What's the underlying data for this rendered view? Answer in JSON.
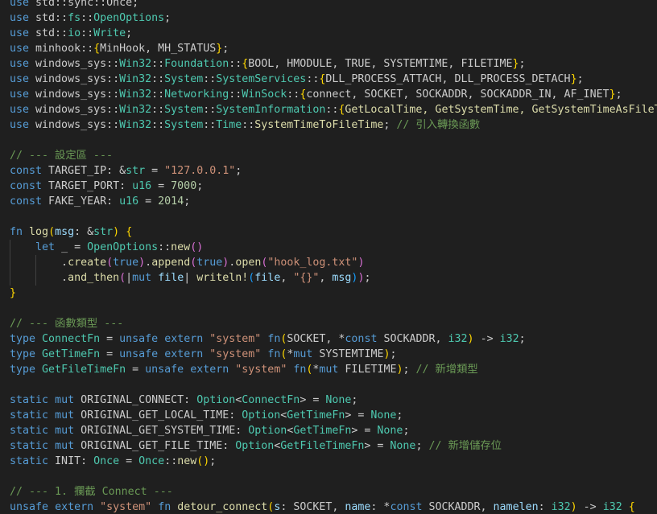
{
  "editor": {
    "colors": {
      "background": "#1f1f1f",
      "text": "#cccccc",
      "keyword": "#569cd6",
      "control": "#c586c0",
      "type": "#4ec9b0",
      "function": "#dcdcaa",
      "string": "#ce9178",
      "number": "#b5cea8",
      "comment": "#6a9955",
      "variable": "#9cdcfe",
      "constant": "#cccccc",
      "bracket_gold": "#ffd700",
      "bracket_purple": "#da70d6",
      "bracket_blue": "#179fff",
      "indent_guide": "#404040"
    },
    "lines": [
      [
        [
          "use",
          "keyword"
        ],
        [
          " std::sync::Once;",
          "text"
        ]
      ],
      [
        [
          "use",
          "keyword"
        ],
        [
          " std::",
          "text"
        ],
        [
          "fs",
          "type"
        ],
        [
          "::",
          "text"
        ],
        [
          "OpenOptions",
          "type"
        ],
        [
          ";",
          "text"
        ]
      ],
      [
        [
          "use",
          "keyword"
        ],
        [
          " std::",
          "text"
        ],
        [
          "io",
          "type"
        ],
        [
          "::",
          "text"
        ],
        [
          "Write",
          "type"
        ],
        [
          ";",
          "text"
        ]
      ],
      [
        [
          "use",
          "keyword"
        ],
        [
          " minhook::",
          "text"
        ],
        [
          "{",
          "bracket_gold"
        ],
        [
          "MinHook, MH_STATUS",
          "text"
        ],
        [
          "}",
          "bracket_gold"
        ],
        [
          ";",
          "text"
        ]
      ],
      [
        [
          "use",
          "keyword"
        ],
        [
          " windows_sys",
          "text"
        ],
        [
          "::",
          "text"
        ],
        [
          "Win32",
          "type"
        ],
        [
          "::",
          "text"
        ],
        [
          "Foundation",
          "type"
        ],
        [
          "::",
          "text"
        ],
        [
          "{",
          "bracket_gold"
        ],
        [
          "BOOL, HMODULE, TRUE, SYSTEMTIME, FILETIME",
          "text"
        ],
        [
          "}",
          "bracket_gold"
        ],
        [
          ";",
          "text"
        ]
      ],
      [
        [
          "use",
          "keyword"
        ],
        [
          " windows_sys",
          "text"
        ],
        [
          "::",
          "text"
        ],
        [
          "Win32",
          "type"
        ],
        [
          "::",
          "text"
        ],
        [
          "System",
          "type"
        ],
        [
          "::",
          "text"
        ],
        [
          "SystemServices",
          "type"
        ],
        [
          "::",
          "text"
        ],
        [
          "{",
          "bracket_gold"
        ],
        [
          "DLL_PROCESS_ATTACH, DLL_PROCESS_DETACH",
          "text"
        ],
        [
          "}",
          "bracket_gold"
        ],
        [
          ";",
          "text"
        ]
      ],
      [
        [
          "use",
          "keyword"
        ],
        [
          " windows_sys",
          "text"
        ],
        [
          "::",
          "text"
        ],
        [
          "Win32",
          "type"
        ],
        [
          "::",
          "text"
        ],
        [
          "Networking",
          "type"
        ],
        [
          "::",
          "text"
        ],
        [
          "WinSock",
          "type"
        ],
        [
          "::",
          "text"
        ],
        [
          "{",
          "bracket_gold"
        ],
        [
          "connect, SOCKET, SOCKADDR, SOCKADDR_IN, AF_INET",
          "text"
        ],
        [
          "}",
          "bracket_gold"
        ],
        [
          ";",
          "text"
        ]
      ],
      [
        [
          "use",
          "keyword"
        ],
        [
          " windows_sys",
          "text"
        ],
        [
          "::",
          "text"
        ],
        [
          "Win32",
          "type"
        ],
        [
          "::",
          "text"
        ],
        [
          "System",
          "type"
        ],
        [
          "::",
          "text"
        ],
        [
          "SystemInformation",
          "type"
        ],
        [
          "::",
          "text"
        ],
        [
          "{",
          "bracket_gold"
        ],
        [
          "GetLocalTime, GetSystemTime, GetSystemTimeAsFileTime",
          "function"
        ]
      ],
      [
        [
          "use",
          "keyword"
        ],
        [
          " windows_sys",
          "text"
        ],
        [
          "::",
          "text"
        ],
        [
          "Win32",
          "type"
        ],
        [
          "::",
          "text"
        ],
        [
          "System",
          "type"
        ],
        [
          "::",
          "text"
        ],
        [
          "Time",
          "type"
        ],
        [
          "::",
          "text"
        ],
        [
          "SystemTimeToFileTime",
          "function"
        ],
        [
          ";",
          "text"
        ],
        [
          " // 引入轉換函數",
          "comment"
        ]
      ],
      [],
      [
        [
          "// --- 設定區 ---",
          "comment"
        ]
      ],
      [
        [
          "const",
          "keyword"
        ],
        [
          " TARGET_IP: &",
          "text"
        ],
        [
          "str",
          "type"
        ],
        [
          " = ",
          "text"
        ],
        [
          "\"127.0.0.1\"",
          "string"
        ],
        [
          ";",
          "text"
        ]
      ],
      [
        [
          "const",
          "keyword"
        ],
        [
          " TARGET_PORT: ",
          "text"
        ],
        [
          "u16",
          "type"
        ],
        [
          " = ",
          "text"
        ],
        [
          "7000",
          "number"
        ],
        [
          ";",
          "text"
        ]
      ],
      [
        [
          "const",
          "keyword"
        ],
        [
          " FAKE_YEAR: ",
          "text"
        ],
        [
          "u16",
          "type"
        ],
        [
          " = ",
          "text"
        ],
        [
          "2014",
          "number"
        ],
        [
          ";",
          "text"
        ]
      ],
      [],
      [
        [
          "fn",
          "keyword"
        ],
        [
          " ",
          "text"
        ],
        [
          "log",
          "function"
        ],
        [
          "(",
          "bracket_gold"
        ],
        [
          "msg",
          "variable"
        ],
        [
          ": &",
          "text"
        ],
        [
          "str",
          "type"
        ],
        [
          ")",
          "bracket_gold"
        ],
        [
          " ",
          "text"
        ],
        [
          "{",
          "bracket_gold"
        ]
      ],
      [
        [
          "    ",
          "text"
        ],
        [
          "let",
          "keyword"
        ],
        [
          " _ = ",
          "text"
        ],
        [
          "OpenOptions",
          "type"
        ],
        [
          "::",
          "text"
        ],
        [
          "new",
          "function"
        ],
        [
          "()",
          "bracket_purple"
        ]
      ],
      [
        [
          "        .",
          "text"
        ],
        [
          "create",
          "function"
        ],
        [
          "(",
          "bracket_purple"
        ],
        [
          "true",
          "keyword"
        ],
        [
          ")",
          "bracket_purple"
        ],
        [
          ".",
          "text"
        ],
        [
          "append",
          "function"
        ],
        [
          "(",
          "bracket_purple"
        ],
        [
          "true",
          "keyword"
        ],
        [
          ")",
          "bracket_purple"
        ],
        [
          ".",
          "text"
        ],
        [
          "open",
          "function"
        ],
        [
          "(",
          "bracket_purple"
        ],
        [
          "\"hook_log.txt\"",
          "string"
        ],
        [
          ")",
          "bracket_purple"
        ]
      ],
      [
        [
          "        .",
          "text"
        ],
        [
          "and_then",
          "function"
        ],
        [
          "(",
          "bracket_purple"
        ],
        [
          "|",
          "text"
        ],
        [
          "mut",
          "keyword"
        ],
        [
          " ",
          "text"
        ],
        [
          "file",
          "variable"
        ],
        [
          "| ",
          "text"
        ],
        [
          "writeln!",
          "function"
        ],
        [
          "(",
          "bracket_blue"
        ],
        [
          "file",
          "variable"
        ],
        [
          ", ",
          "text"
        ],
        [
          "\"{}\"",
          "string"
        ],
        [
          ", ",
          "text"
        ],
        [
          "msg",
          "variable"
        ],
        [
          ")",
          "bracket_blue"
        ],
        [
          ")",
          "bracket_purple"
        ],
        [
          ";",
          "text"
        ]
      ],
      [
        [
          "}",
          "bracket_gold"
        ]
      ],
      [],
      [
        [
          "// --- 函數類型 ---",
          "comment"
        ]
      ],
      [
        [
          "type",
          "keyword"
        ],
        [
          " ",
          "text"
        ],
        [
          "ConnectFn",
          "type"
        ],
        [
          " = ",
          "text"
        ],
        [
          "unsafe",
          "keyword"
        ],
        [
          " ",
          "text"
        ],
        [
          "extern",
          "keyword"
        ],
        [
          " ",
          "text"
        ],
        [
          "\"system\"",
          "string"
        ],
        [
          " ",
          "text"
        ],
        [
          "fn",
          "keyword"
        ],
        [
          "(",
          "bracket_gold"
        ],
        [
          "SOCKET, *",
          "text"
        ],
        [
          "const",
          "keyword"
        ],
        [
          " SOCKADDR, ",
          "text"
        ],
        [
          "i32",
          "type"
        ],
        [
          ")",
          "bracket_gold"
        ],
        [
          " -> ",
          "text"
        ],
        [
          "i32",
          "type"
        ],
        [
          ";",
          "text"
        ]
      ],
      [
        [
          "type",
          "keyword"
        ],
        [
          " ",
          "text"
        ],
        [
          "GetTimeFn",
          "type"
        ],
        [
          " = ",
          "text"
        ],
        [
          "unsafe",
          "keyword"
        ],
        [
          " ",
          "text"
        ],
        [
          "extern",
          "keyword"
        ],
        [
          " ",
          "text"
        ],
        [
          "\"system\"",
          "string"
        ],
        [
          " ",
          "text"
        ],
        [
          "fn",
          "keyword"
        ],
        [
          "(",
          "bracket_gold"
        ],
        [
          "*",
          "text"
        ],
        [
          "mut",
          "keyword"
        ],
        [
          " SYSTEMTIME",
          "text"
        ],
        [
          ")",
          "bracket_gold"
        ],
        [
          ";",
          "text"
        ]
      ],
      [
        [
          "type",
          "keyword"
        ],
        [
          " ",
          "text"
        ],
        [
          "GetFileTimeFn",
          "type"
        ],
        [
          " = ",
          "text"
        ],
        [
          "unsafe",
          "keyword"
        ],
        [
          " ",
          "text"
        ],
        [
          "extern",
          "keyword"
        ],
        [
          " ",
          "text"
        ],
        [
          "\"system\"",
          "string"
        ],
        [
          " ",
          "text"
        ],
        [
          "fn",
          "keyword"
        ],
        [
          "(",
          "bracket_gold"
        ],
        [
          "*",
          "text"
        ],
        [
          "mut",
          "keyword"
        ],
        [
          " FILETIME",
          "text"
        ],
        [
          ")",
          "bracket_gold"
        ],
        [
          ";",
          "text"
        ],
        [
          " // 新增類型",
          "comment"
        ]
      ],
      [],
      [
        [
          "static",
          "keyword"
        ],
        [
          " ",
          "text"
        ],
        [
          "mut",
          "keyword"
        ],
        [
          " ORIGINAL_CONNECT: ",
          "text"
        ],
        [
          "Option",
          "type"
        ],
        [
          "<",
          "text"
        ],
        [
          "ConnectFn",
          "type"
        ],
        [
          "> = ",
          "text"
        ],
        [
          "None",
          "type"
        ],
        [
          ";",
          "text"
        ]
      ],
      [
        [
          "static",
          "keyword"
        ],
        [
          " ",
          "text"
        ],
        [
          "mut",
          "keyword"
        ],
        [
          " ORIGINAL_GET_LOCAL_TIME: ",
          "text"
        ],
        [
          "Option",
          "type"
        ],
        [
          "<",
          "text"
        ],
        [
          "GetTimeFn",
          "type"
        ],
        [
          "> = ",
          "text"
        ],
        [
          "None",
          "type"
        ],
        [
          ";",
          "text"
        ]
      ],
      [
        [
          "static",
          "keyword"
        ],
        [
          " ",
          "text"
        ],
        [
          "mut",
          "keyword"
        ],
        [
          " ORIGINAL_GET_SYSTEM_TIME: ",
          "text"
        ],
        [
          "Option",
          "type"
        ],
        [
          "<",
          "text"
        ],
        [
          "GetTimeFn",
          "type"
        ],
        [
          "> = ",
          "text"
        ],
        [
          "None",
          "type"
        ],
        [
          ";",
          "text"
        ]
      ],
      [
        [
          "static",
          "keyword"
        ],
        [
          " ",
          "text"
        ],
        [
          "mut",
          "keyword"
        ],
        [
          " ORIGINAL_GET_FILE_TIME: ",
          "text"
        ],
        [
          "Option",
          "type"
        ],
        [
          "<",
          "text"
        ],
        [
          "GetFileTimeFn",
          "type"
        ],
        [
          "> = ",
          "text"
        ],
        [
          "None",
          "type"
        ],
        [
          ";",
          "text"
        ],
        [
          " // 新增儲存位",
          "comment"
        ]
      ],
      [
        [
          "static",
          "keyword"
        ],
        [
          " INIT: ",
          "text"
        ],
        [
          "Once",
          "type"
        ],
        [
          " = ",
          "text"
        ],
        [
          "Once",
          "type"
        ],
        [
          "::",
          "text"
        ],
        [
          "new",
          "function"
        ],
        [
          "()",
          "bracket_gold"
        ],
        [
          ";",
          "text"
        ]
      ],
      [],
      [
        [
          "// --- 1. 攔截 Connect ---",
          "comment"
        ]
      ],
      [
        [
          "unsafe",
          "keyword"
        ],
        [
          " ",
          "text"
        ],
        [
          "extern",
          "keyword"
        ],
        [
          " ",
          "text"
        ],
        [
          "\"system\"",
          "string"
        ],
        [
          " ",
          "text"
        ],
        [
          "fn",
          "keyword"
        ],
        [
          " ",
          "text"
        ],
        [
          "detour_connect",
          "function"
        ],
        [
          "(",
          "bracket_gold"
        ],
        [
          "s",
          "variable"
        ],
        [
          ": SOCKET, ",
          "text"
        ],
        [
          "name",
          "variable"
        ],
        [
          ": *",
          "text"
        ],
        [
          "const",
          "keyword"
        ],
        [
          " SOCKADDR, ",
          "text"
        ],
        [
          "namelen",
          "variable"
        ],
        [
          ": ",
          "text"
        ],
        [
          "i32",
          "type"
        ],
        [
          ")",
          "bracket_gold"
        ],
        [
          " -> ",
          "text"
        ],
        [
          "i32",
          "type"
        ],
        [
          " ",
          "text"
        ],
        [
          "{",
          "bracket_gold"
        ]
      ]
    ]
  }
}
